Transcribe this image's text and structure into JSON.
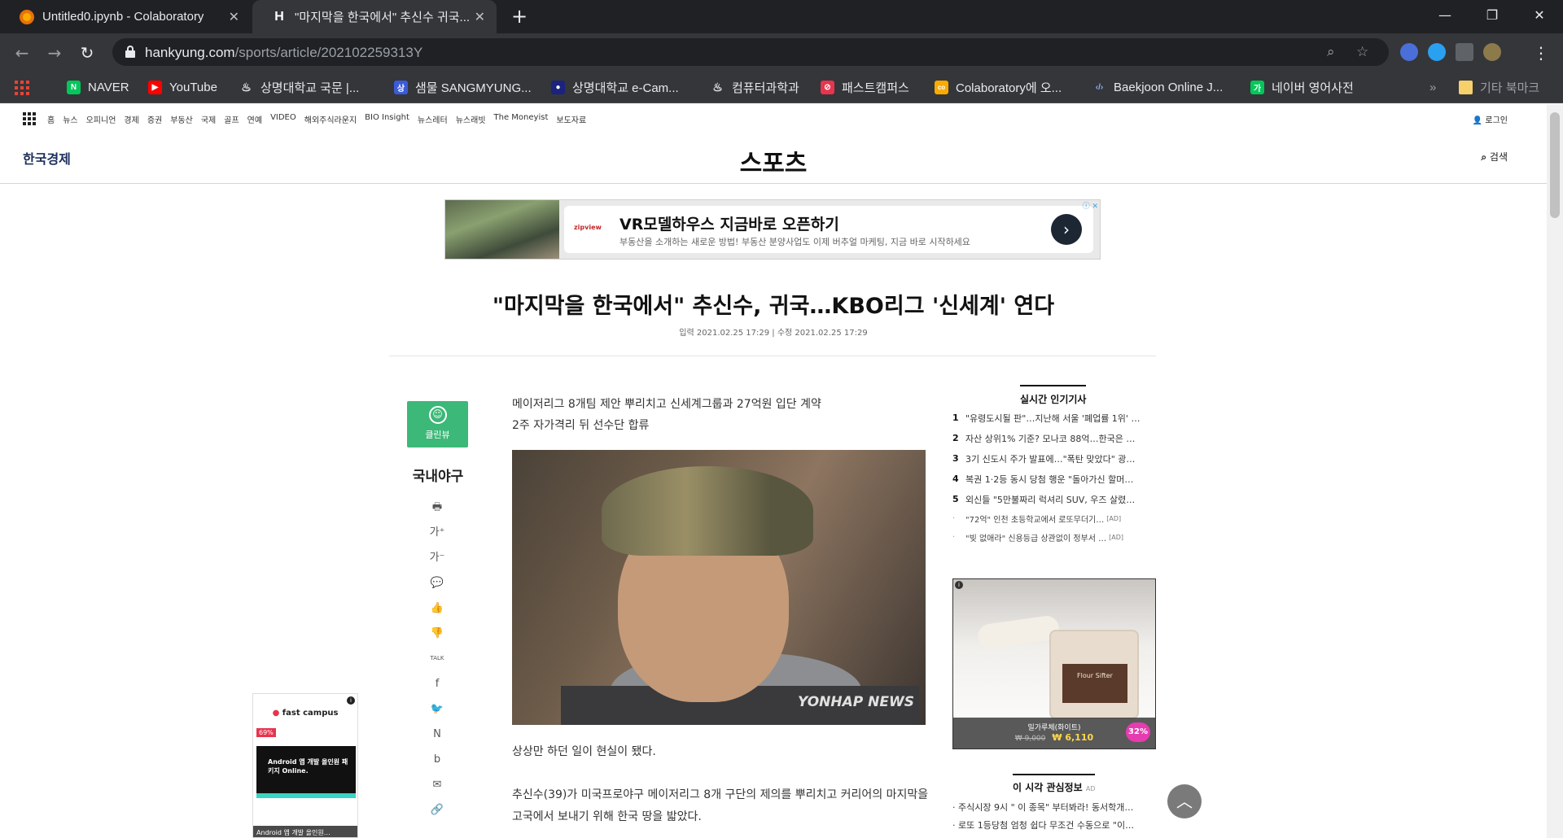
{
  "browser": {
    "tabs": [
      {
        "title": "Untitled0.ipynb - Colaboratory",
        "favicon": "colab-icon",
        "active": false
      },
      {
        "title": "\"마지막을 한국에서\" 추신수 귀국...",
        "favicon": "hankyung-icon",
        "active": true
      }
    ],
    "favicon_letter": "H",
    "new_tab": "+",
    "close_glyph": "✕",
    "window_controls": {
      "minimize": "—",
      "maximize": "❐",
      "close": "✕"
    },
    "address": {
      "host": "hankyung.com",
      "path": "/sports/article/202102259313Y"
    },
    "nav": {
      "back": "←",
      "forward": "→",
      "reload": "↻"
    },
    "omnibox_icons": {
      "zoom": "⌕",
      "star": "☆",
      "menu": "⋮"
    },
    "bookmarks": [
      {
        "label": "NAVER",
        "icon": "naver-icon",
        "color": "#03c75a",
        "glyph": "N"
      },
      {
        "label": "YouTube",
        "icon": "youtube-icon",
        "color": "#ff0000",
        "glyph": "▶"
      },
      {
        "label": "상명대학교 국문 |...",
        "icon": "dotted-icon",
        "color": "#35363a",
        "glyph": "♨"
      },
      {
        "label": "샘물 SANGMYUNG...",
        "icon": "sangmyung-icon",
        "color": "#3b5bdb",
        "glyph": "상"
      },
      {
        "label": "상명대학교 e-Cam...",
        "icon": "ecampus-icon",
        "color": "#1a237e",
        "glyph": "●"
      },
      {
        "label": "컴퓨터과학과",
        "icon": "dotted-icon",
        "color": "#35363a",
        "glyph": "♨"
      },
      {
        "label": "패스트캠퍼스",
        "icon": "fastcampus-icon",
        "color": "#e8344e",
        "glyph": "⊘"
      },
      {
        "label": "Colaboratory에 오...",
        "icon": "colab-icon",
        "color": "#f9ab00",
        "glyph": "co"
      },
      {
        "label": "Baekjoon Online J...",
        "icon": "code-icon",
        "color": "#35363a",
        "glyph": "‹/›"
      },
      {
        "label": "네이버 영어사전",
        "icon": "naver-dict-icon",
        "color": "#03c75a",
        "glyph": "가"
      }
    ],
    "bookmarks_more": "»",
    "other_bookmarks": "기타 북마크"
  },
  "site": {
    "gnb": [
      "홈",
      "뉴스",
      "오피니언",
      "경제",
      "증권",
      "부동산",
      "국제",
      "골프",
      "연예",
      "VIDEO",
      "해외주식라운지",
      "BIO Insight",
      "뉴스레터",
      "뉴스래빗",
      "The Moneyist",
      "보도자료"
    ],
    "login": "로그인",
    "login_icon": "👤",
    "logo": "한국경제",
    "section": "스포츠",
    "search": "검색",
    "search_icon": "⌕"
  },
  "ad_banner": {
    "brand": "zipview",
    "headline": "VR모델하우스 지금바로 오픈하기",
    "sub": "부동산을 소개하는 새로운 방법! 부동산 분양사업도 이제 버추얼 마케팅, 지금 바로 시작하세요",
    "cta_glyph": "›",
    "mark": "ⓘ ✕"
  },
  "article": {
    "title": "\"마지막을 한국에서\" 추신수, 귀국…KBO리그 '신세계' 연다",
    "dateline": "입력 2021.02.25 17:29 | 수정 2021.02.25 17:29",
    "summary": [
      "메이저리그 8개팀 제안 뿌리치고 신세계그룹과 27억원 입단 계약",
      "2주 자가격리 뒤 선수단 합류"
    ],
    "photo_credit": "YONHAP NEWS",
    "paragraph1": "상상만 하던 일이 현실이 됐다.",
    "paragraph2": "추신수(39)가 미국프로야구 메이저리그 8개 구단의 제의를 뿌리치고 커리어의 마지막을 고국에서 보내기 위해 한국 땅을 밟았다.",
    "clean_view": "클린뷰",
    "clean_glyph": "☺",
    "category": "국내야구",
    "tools": [
      {
        "name": "print-icon",
        "glyph": "🖶"
      },
      {
        "name": "font-larger-icon",
        "glyph": "가⁺"
      },
      {
        "name": "font-smaller-icon",
        "glyph": "가⁻"
      },
      {
        "name": "comment-icon",
        "glyph": "💬"
      },
      {
        "name": "like-icon",
        "glyph": "👍"
      },
      {
        "name": "dislike-icon",
        "glyph": "👎"
      },
      {
        "name": "kakaotalk-icon",
        "glyph": "TALK"
      },
      {
        "name": "facebook-icon",
        "glyph": "f"
      },
      {
        "name": "twitter-icon",
        "glyph": "🐦"
      },
      {
        "name": "naver-share-icon",
        "glyph": "N"
      },
      {
        "name": "band-icon",
        "glyph": "b"
      },
      {
        "name": "email-icon",
        "glyph": "✉"
      },
      {
        "name": "link-icon",
        "glyph": "🔗"
      }
    ]
  },
  "sidebar": {
    "popular_title": "실시간 인기기사",
    "popular": [
      {
        "num": "1",
        "text": "\"유령도시될 판\"…지난해 서울 '폐업률 1위' …"
      },
      {
        "num": "2",
        "text": "자산 상위1% 기준? 모나코 88억…한국은 …"
      },
      {
        "num": "3",
        "text": "3기 신도시 주가 발표에…\"폭탄 맞았다\" 광…"
      },
      {
        "num": "4",
        "text": "복권 1·2등 동시 당첨 행운 \"돌아가신 할머…"
      },
      {
        "num": "5",
        "text": "외신들 \"5만불짜리 럭셔리 SUV, 우즈 살렸…"
      }
    ],
    "popular_ads": [
      {
        "num": "·",
        "text": "\"72억\" 인천 초등학교에서 로또무더기…",
        "tag": "[AD]"
      },
      {
        "num": "·",
        "text": "\"빚 없애라\" 신용등급 상관없이 정부서 …",
        "tag": "[AD]"
      }
    ],
    "product": {
      "label": "Flour Sifter",
      "name": "밀가루체(화이트)",
      "old_price": "₩ 9,000",
      "new_price": "₩ 6,110",
      "discount": "32%",
      "info": "i"
    },
    "interest_title": "이 시각 관심정보",
    "interest_ad": "AD",
    "interest": [
      "· 주식시장 9시 \" 이 종목\" 부터봐라! 동서학개…",
      "· 로또 1등당첨 엄청 쉽다 무조건 수동으로 \"이…"
    ]
  },
  "float_ad": {
    "brand": "fast campus",
    "brand_mark": "●",
    "badge": "69%",
    "promo": "Android 앱 개발 올인원 패키지 Online.",
    "caption": "Android 앱 개발 올인원…",
    "close": "i"
  },
  "to_top": "︿"
}
